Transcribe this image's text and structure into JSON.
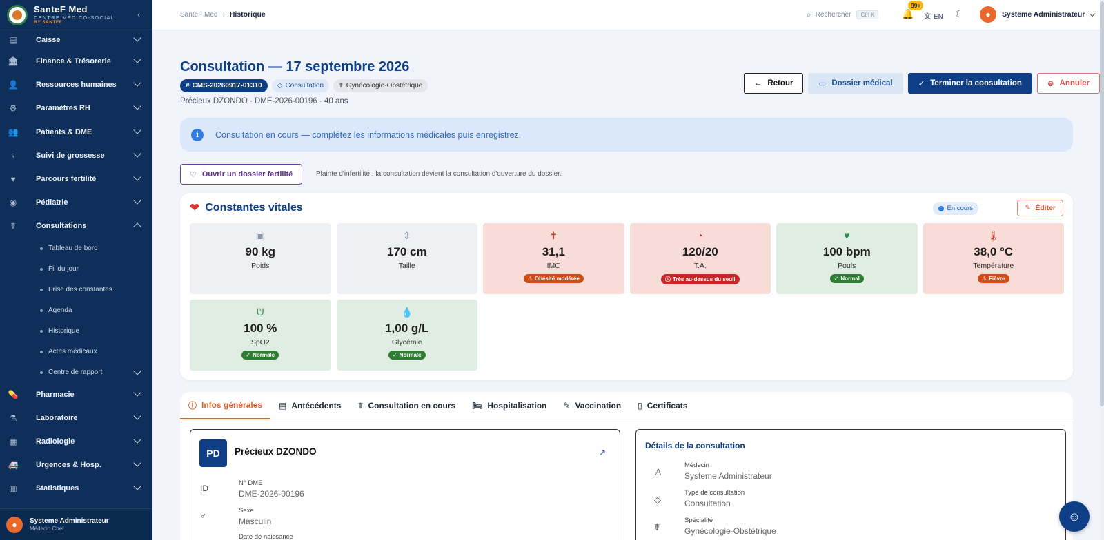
{
  "brand": {
    "name": "SanteF Med",
    "subtitle": "CENTRE MÉDICO-SOCIAL",
    "by": "BY SANTEF"
  },
  "sidebar": {
    "items": [
      {
        "label": "Caisse",
        "icon": "cash-register-icon"
      },
      {
        "label": "Finance & Trésorerie",
        "icon": "bank-icon"
      },
      {
        "label": "Ressources humaines",
        "icon": "person-icon"
      },
      {
        "label": "Paramètres RH",
        "icon": "person-gear-icon"
      },
      {
        "label": "Patients & DME",
        "icon": "group-icon"
      },
      {
        "label": "Suivi de grossesse",
        "icon": "pregnant-icon"
      },
      {
        "label": "Parcours fertilité",
        "icon": "heart-hand-icon"
      },
      {
        "label": "Pédiatrie",
        "icon": "eye-icon"
      },
      {
        "label": "Consultations",
        "icon": "stethoscope-icon"
      }
    ],
    "consultation_subitems": [
      "Tableau de bord",
      "Fil du jour",
      "Prise des constantes",
      "Agenda",
      "Historique",
      "Actes médicaux",
      "Centre de rapport"
    ],
    "items_after": [
      {
        "label": "Pharmacie",
        "icon": "pill-icon"
      },
      {
        "label": "Laboratoire",
        "icon": "flask-icon"
      },
      {
        "label": "Radiologie",
        "icon": "xray-icon"
      },
      {
        "label": "Urgences & Hosp.",
        "icon": "ambulance-icon"
      },
      {
        "label": "Statistiques",
        "icon": "bar-chart-icon"
      }
    ],
    "user": {
      "name": "Systeme Administrateur",
      "role": "Médecin Chef"
    }
  },
  "topbar": {
    "breadcrumb_root": "SanteF Med",
    "breadcrumb_current": "Historique",
    "search_label": "Rechercher",
    "search_shortcut": "Ctrl K",
    "notif_count": "99+",
    "lang": "EN",
    "user_name": "Systeme Administrateur"
  },
  "page": {
    "title": "Consultation — 17 septembre 2026",
    "tags": {
      "code": "CMS-20260917-01310",
      "type": "Consultation",
      "specialty": "Gynécologie-Obstétrique"
    },
    "subline": "Précieux DZONDO · DME-2026-00196 · 40 ans",
    "buttons": {
      "back": "Retour",
      "dossier": "Dossier médical",
      "finish": "Terminer la consultation",
      "cancel": "Annuler"
    },
    "banner": "Consultation en cours — complétez les informations médicales puis enregistrez.",
    "fertility_button": "Ouvrir un dossier fertilité",
    "fertility_note": "Plainte d'infertilité : la consultation devient la consultation d'ouverture du dossier."
  },
  "vitals": {
    "title": "Constantes vitales",
    "status": "En cours",
    "edit": "Éditer",
    "cards": [
      {
        "value": "90 kg",
        "label": "Poids",
        "tone": "neutral",
        "icon": "scale-icon"
      },
      {
        "value": "170 cm",
        "label": "Taille",
        "tone": "neutral",
        "icon": "height-icon"
      },
      {
        "value": "31,1",
        "label": "IMC",
        "tone": "alert",
        "icon": "body-icon",
        "badge": "Obésité modérée",
        "badge_color": "orange"
      },
      {
        "value": "120/20",
        "label": "T.A.",
        "tone": "alert",
        "icon": "gauge-icon",
        "badge": "Très au-dessus du seuil",
        "badge_color": "red"
      },
      {
        "value": "100 bpm",
        "label": "Pouls",
        "tone": "ok",
        "icon": "heartbeat-icon",
        "badge": "Normal",
        "badge_color": "green"
      },
      {
        "value": "38,0 °C",
        "label": "Température",
        "tone": "alert",
        "icon": "thermometer-icon",
        "badge": "Fièvre",
        "badge_color": "orange"
      },
      {
        "value": "100 %",
        "label": "SpO2",
        "tone": "ok",
        "icon": "lungs-icon",
        "badge": "Normale",
        "badge_color": "green"
      },
      {
        "value": "1,00 g/L",
        "label": "Glycémie",
        "tone": "ok",
        "icon": "drop-icon",
        "badge": "Normale",
        "badge_color": "green"
      }
    ]
  },
  "tabs": [
    "Infos générales",
    "Antécédents",
    "Consultation en cours",
    "Hospitalisation",
    "Vaccination",
    "Certificats"
  ],
  "patient": {
    "initials": "PD",
    "name": "Précieux DZONDO",
    "dme_label": "N° DME",
    "dme_value": "DME-2026-00196",
    "sex_label": "Sexe",
    "sex_value": "Masculin",
    "dob_label": "Date de naissance"
  },
  "details": {
    "title": "Détails de la consultation",
    "doctor_label": "Médecin",
    "doctor_value": "Systeme Administrateur",
    "type_label": "Type de consultation",
    "type_value": "Consultation",
    "spec_label": "Spécialité",
    "spec_value": "Gynécologie-Obstétrique"
  }
}
